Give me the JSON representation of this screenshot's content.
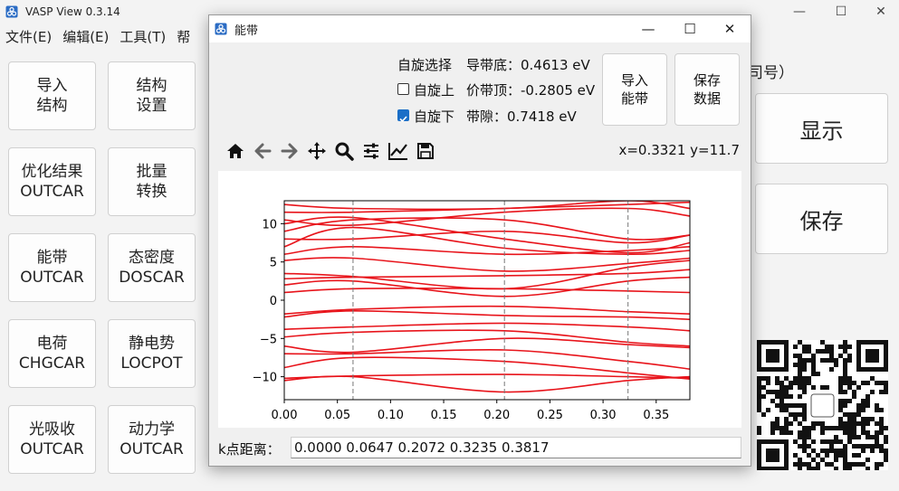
{
  "app": {
    "title": "VASP View 0.3.14",
    "controls": {
      "minimize": "—",
      "maximize": "☐",
      "close": "✕"
    }
  },
  "menu": [
    "文件(E)",
    "编辑(E)",
    "工具(T)",
    "帮"
  ],
  "tiles": [
    {
      "l1": "导入",
      "l2": "结构"
    },
    {
      "l1": "结构",
      "l2": "设置"
    },
    {
      "l1": "优化结果",
      "l2": "OUTCAR"
    },
    {
      "l1": "批量",
      "l2": "转换"
    },
    {
      "l1": "能带",
      "l2": "OUTCAR"
    },
    {
      "l1": "态密度",
      "l2": "DOSCAR"
    },
    {
      "l1": "电荷",
      "l2": "CHGCAR"
    },
    {
      "l1": "静电势",
      "l2": "LOCPOT"
    },
    {
      "l1": "光吸收",
      "l2": "OUTCAR"
    },
    {
      "l1": "动力学",
      "l2": "OUTCAR"
    }
  ],
  "right": {
    "hint": "司号）",
    "show": "显示",
    "save": "保存"
  },
  "dialog": {
    "title": "能带",
    "controls": {
      "minimize": "—",
      "maximize": "☐",
      "close": "✕"
    },
    "spin_title": "自旋选择",
    "spin_up": "自旋上",
    "spin_up_checked": false,
    "spin_down": "自旋下",
    "spin_down_checked": true,
    "cbm": "导带底：0.4613 eV",
    "vbm": "价带顶：-0.2805 eV",
    "gap": "带隙：0.7418 eV",
    "import_btn": [
      "导入",
      "能带"
    ],
    "save_btn": [
      "保存",
      "数据"
    ],
    "coord": "x=0.3321 y=11.7",
    "kdist_label": "k点距离：",
    "kdist_value": "0.0000 0.0647 0.2072 0.3235 0.3817"
  },
  "chart_data": {
    "type": "line",
    "title": "",
    "xlabel": "",
    "ylabel": "",
    "xlim": [
      0,
      0.3817
    ],
    "ylim": [
      -13,
      13
    ],
    "xticks": [
      0.0,
      0.05,
      0.1,
      0.15,
      0.2,
      0.25,
      0.3,
      0.35
    ],
    "xtick_labels": [
      "0.00",
      "0.05",
      "0.10",
      "0.15",
      "0.20",
      "0.25",
      "0.30",
      "0.35"
    ],
    "yticks": [
      -10,
      -5,
      0,
      5,
      10
    ],
    "ytick_labels": [
      "−10",
      "−5",
      "0",
      "5",
      "10"
    ],
    "kpoint_lines": [
      0.0647,
      0.2072,
      0.3235
    ],
    "color": "#e8141b",
    "kx": [
      0.0,
      0.0647,
      0.2072,
      0.3235,
      0.3817
    ],
    "bands": [
      [
        -10.5,
        -10.0,
        -12.0,
        -10.5,
        -10.0
      ],
      [
        -10.2,
        -9.9,
        -9.7,
        -10.0,
        -10.2
      ],
      [
        -8.8,
        -7.5,
        -8.0,
        -9.5,
        -10.3
      ],
      [
        -7.0,
        -7.0,
        -6.5,
        -8.0,
        -9.0
      ],
      [
        -6.0,
        -6.8,
        -5.0,
        -5.8,
        -6.2
      ],
      [
        -4.8,
        -4.2,
        -4.0,
        -5.5,
        -6.0
      ],
      [
        -3.8,
        -3.5,
        -3.0,
        -3.5,
        -4.0
      ],
      [
        -2.2,
        -1.4,
        -2.0,
        -2.2,
        -2.5
      ],
      [
        -1.8,
        -1.2,
        -0.8,
        -1.5,
        -1.8
      ],
      [
        1.0,
        1.5,
        1.5,
        1.2,
        1.0
      ],
      [
        2.0,
        2.5,
        0.5,
        2.5,
        3.0
      ],
      [
        2.8,
        3.0,
        3.2,
        3.5,
        4.0
      ],
      [
        3.5,
        3.1,
        1.5,
        4.3,
        5.2
      ],
      [
        5.2,
        5.5,
        3.8,
        4.8,
        5.5
      ],
      [
        6.0,
        7.0,
        6.0,
        6.5,
        7.0
      ],
      [
        7.0,
        9.5,
        6.8,
        6.0,
        6.5
      ],
      [
        8.0,
        8.0,
        9.0,
        7.5,
        8.5
      ],
      [
        9.0,
        10.5,
        10.5,
        8.0,
        8.5
      ],
      [
        10.0,
        10.8,
        8.0,
        6.2,
        7.5
      ],
      [
        10.5,
        9.8,
        11.5,
        12.0,
        11.0
      ],
      [
        11.5,
        11.5,
        12.0,
        12.5,
        12.8
      ],
      [
        12.5,
        12.0,
        12.0,
        13.0,
        12.0
      ]
    ]
  }
}
